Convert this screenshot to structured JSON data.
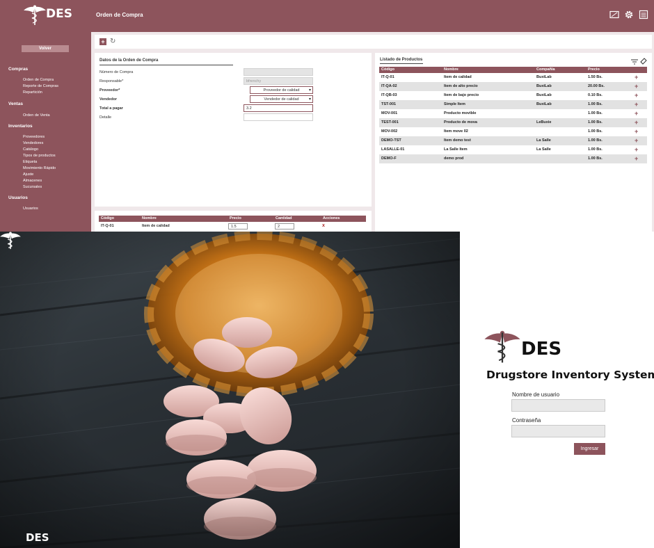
{
  "app": {
    "logo_text": "DES",
    "page_title": "Orden de Compra",
    "colors": {
      "brand": "#8d545c",
      "brand_light": "#b98b90",
      "bg": "#f0e8ea",
      "alt_row": "#e2e2e2",
      "delete": "#b02a2a"
    },
    "header_icons": [
      "screen-icon",
      "gear-icon",
      "list-icon"
    ],
    "sidebar": {
      "back_label": "Volver",
      "sections": [
        {
          "title": "Compras",
          "items": [
            "Orden de Compra",
            "Reporte de Compras",
            "Repartición"
          ]
        },
        {
          "title": "Ventas",
          "items": [
            "Orden de Venta"
          ]
        },
        {
          "title": "Inventarios",
          "items": [
            "Proveedores",
            "Vendedores",
            "Catálogo",
            "Tipos de productos",
            "Etiqueta",
            "Movimiento Rápido",
            "Ajuste",
            "Almacenes",
            "Sucursales"
          ]
        },
        {
          "title": "Usuarios",
          "items": [
            "Usuarios"
          ]
        }
      ]
    },
    "toolbar": {
      "add_icon": "plus-icon",
      "refresh_icon": "refresh-icon"
    },
    "order_form": {
      "title": "Datos de la Orden de Compra",
      "fields": [
        {
          "label": "Número de Compra",
          "value": "",
          "kind": "disabled",
          "bold": false
        },
        {
          "label": "Responsable*",
          "value": "bfrenchy",
          "kind": "disabled",
          "bold": false
        },
        {
          "label": "Proveedor*",
          "value": "Proveedor de calidad",
          "kind": "select",
          "bold": true
        },
        {
          "label": "Vendedor",
          "value": "Vendedor de calidad",
          "kind": "select",
          "bold": true
        },
        {
          "label": "Total a pagar",
          "value": "3.2",
          "kind": "input",
          "bold": true
        },
        {
          "label": "Detalle",
          "value": "",
          "kind": "plain",
          "bold": false
        }
      ]
    },
    "order_items": {
      "headers": [
        "Código",
        "Nombre",
        "Precio",
        "Cantidad",
        "Acciones"
      ],
      "rows": [
        {
          "code": "IT-Q-01",
          "name": "Item de calidad",
          "price": "1.5",
          "qty": "2",
          "action": "x"
        }
      ]
    },
    "products": {
      "title": "Listado de Productos",
      "tool_icons": [
        "filter-icon",
        "eraser-icon"
      ],
      "headers": [
        "Código",
        "Nombre",
        "Compañía",
        "Precio"
      ],
      "rows": [
        {
          "code": "IT-Q-01",
          "name": "Item de calidad",
          "company": "BuxiLab",
          "price": "1.50 Bs."
        },
        {
          "code": "IT-QA-02",
          "name": "Item de alto precio",
          "company": "BuxiLab",
          "price": "20.00 Bs."
        },
        {
          "code": "IT-QB-03",
          "name": "Item de bajo precio",
          "company": "BuxiLab",
          "price": "0.10 Bs."
        },
        {
          "code": "TST-001",
          "name": "Simple Item",
          "company": "BuxiLab",
          "price": "1.00 Bs."
        },
        {
          "code": "MOV-001",
          "name": "Producto movible",
          "company": "",
          "price": "1.00 Bs."
        },
        {
          "code": "TEST-001",
          "name": "Producto de mova",
          "company": "LeBuxie",
          "price": "1.00 Bs."
        },
        {
          "code": "MOV-002",
          "name": "Item move 02",
          "company": "",
          "price": "1.00 Bs."
        },
        {
          "code": "DEMO-TST",
          "name": "Item demo test",
          "company": "La Salle",
          "price": "1.00 Bs."
        },
        {
          "code": "LASALLE-01",
          "name": "La Salle Item",
          "company": "La Salle",
          "price": "1.00 Bs."
        },
        {
          "code": "DEMO-F",
          "name": "demo prod",
          "company": "",
          "price": "1.00 Bs."
        }
      ],
      "add_symbol": "+"
    }
  },
  "photo": {
    "logo_text": "DES"
  },
  "login": {
    "logo_text": "DES",
    "system_title": "Drugstore Inventory System",
    "username_label": "Nombre de usuario",
    "password_label": "Contraseña",
    "submit_label": "Ingresar"
  }
}
